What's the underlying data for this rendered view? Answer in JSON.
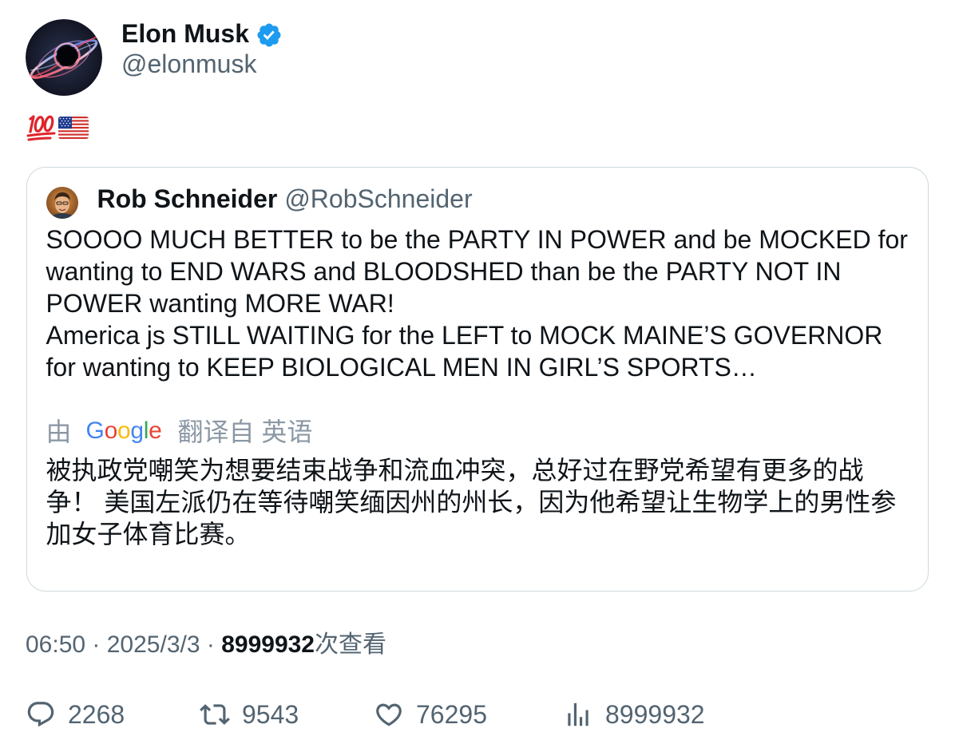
{
  "author": {
    "name": "Elon Musk",
    "handle": "@elonmusk",
    "verified_icon": "verified-badge-icon"
  },
  "tweet": {
    "emoji_icons": [
      "hundred-points-icon",
      "us-flag-icon"
    ]
  },
  "quoted_tweet": {
    "author_name": "Rob Schneider",
    "author_handle": "@RobSchneider",
    "lines": [
      "SOOOO MUCH BETTER to be the PARTY IN POWER and be MOCKED for",
      "wanting to END WARS and BLOODSHED than be the PARTY NOT IN",
      "POWER wanting MORE WAR!",
      "America js STILL WAITING for the LEFT to MOCK MAINE’S GOVERNOR",
      "for wanting to KEEP BIOLOGICAL MEN IN GIRL’S SPORTS…"
    ]
  },
  "translation": {
    "prefix": "由",
    "logo_letters": [
      "G",
      "o",
      "o",
      "g",
      "l",
      "e"
    ],
    "logo_colors": [
      "#4285F4",
      "#EA4335",
      "#FBBC05",
      "#4285F4",
      "#34A853",
      "#EA4335"
    ],
    "suffix": "翻译自 英语",
    "lines": [
      "被执政党嘲笑为想要结束战争和流血冲突，总好过在野党希望有更多的战",
      "争！ 美国左派仍在等待嘲笑缅因州的州长，因为他希望让生物学上的男性参",
      "加女子体育比赛。"
    ]
  },
  "meta": {
    "time": "06:50",
    "separator": " · ",
    "date": "2025/3/3",
    "views": "8999932",
    "views_suffix": "次查看"
  },
  "actions": [
    {
      "icon": "reply-icon",
      "count": "2268"
    },
    {
      "icon": "retweet-icon",
      "count": "9543"
    },
    {
      "icon": "like-icon",
      "count": "76295"
    },
    {
      "icon": "views-icon",
      "count": "8999932"
    }
  ],
  "colors": {
    "text": "#0f1419",
    "secondary": "#536471",
    "translation_label": "#8b98a5",
    "border": "#cfd9de",
    "verified": "#1d9bf0",
    "emoji_red": "#e0242b"
  }
}
